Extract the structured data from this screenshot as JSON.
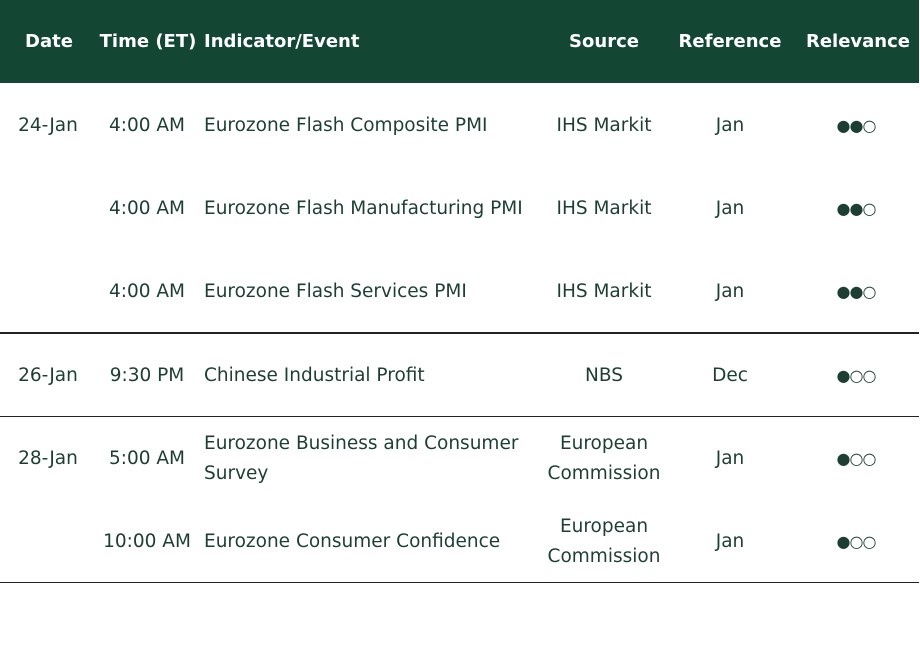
{
  "header": {
    "date": "Date",
    "time": "Time (ET)",
    "indicator": "Indicator/Event",
    "source": "Source",
    "reference": "Reference",
    "relevance": "Relevance"
  },
  "rows": [
    {
      "date": "24-Jan",
      "time": "4:00 AM",
      "indicator": "Eurozone Flash Composite PMI",
      "source": "IHS Markit",
      "reference": "Jan",
      "relevance": "●●○"
    },
    {
      "date": "",
      "time": "4:00 AM",
      "indicator": "Eurozone Flash Manufacturing PMI",
      "source": "IHS Markit",
      "reference": "Jan",
      "relevance": "●●○"
    },
    {
      "date": "",
      "time": "4:00 AM",
      "indicator": "Eurozone Flash Services PMI",
      "source": "IHS Markit",
      "reference": "Jan",
      "relevance": "●●○"
    },
    {
      "date": "26-Jan",
      "time": "9:30 PM",
      "indicator": "Chinese Industrial Profit",
      "source": "NBS",
      "reference": "Dec",
      "relevance": "●○○"
    },
    {
      "date": "28-Jan",
      "time": "5:00 AM",
      "indicator": "Eurozone Business and Consumer Survey",
      "source": "European Commission",
      "reference": "Jan",
      "relevance": "●○○"
    },
    {
      "date": "",
      "time": "10:00 AM",
      "indicator": "Eurozone Consumer Confidence",
      "source": "European Commission",
      "reference": "Jan",
      "relevance": "●○○"
    }
  ],
  "colors": {
    "header_bg": "#134734",
    "header_text": "#ffffff",
    "body_text": "#1d3f33"
  }
}
